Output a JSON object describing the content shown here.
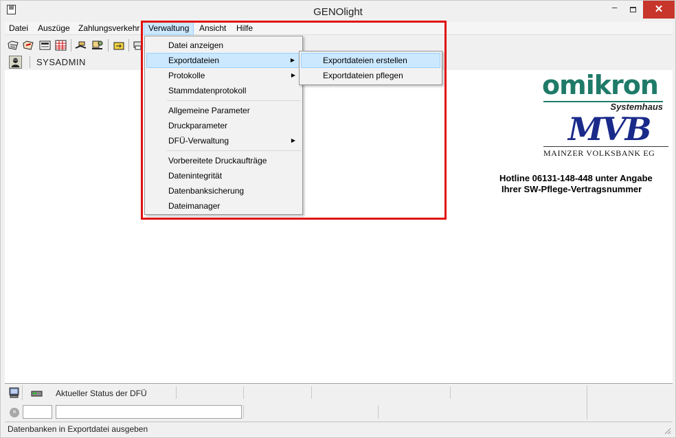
{
  "window": {
    "title": "GENOlight",
    "minimize_glyph": "–",
    "close_glyph": "✕"
  },
  "menubar": {
    "items": [
      {
        "label": "Datei"
      },
      {
        "label": "Auszüge"
      },
      {
        "label": "Zahlungsverkehr"
      },
      {
        "label": "Verwaltung",
        "active": true
      },
      {
        "label": "Ansicht"
      },
      {
        "label": "Hilfe"
      }
    ]
  },
  "user": {
    "name": "SYSADMIN"
  },
  "dropdown": {
    "items": [
      {
        "label": "Datei anzeigen"
      },
      {
        "label": "Exportdateien",
        "submenu": true,
        "highlighted": true
      },
      {
        "label": "Protokolle",
        "submenu": true
      },
      {
        "label": "Stammdatenprotokoll"
      },
      {
        "label": "Allgemeine Parameter"
      },
      {
        "label": "Druckparameter"
      },
      {
        "label": "DFÜ-Verwaltung",
        "submenu": true
      },
      {
        "label": "Vorbereitete Druckaufträge"
      },
      {
        "label": "Datenintegrität"
      },
      {
        "label": "Datenbanksicherung"
      },
      {
        "label": "Dateimanager"
      }
    ],
    "arrow": "▶"
  },
  "submenu": {
    "items": [
      {
        "label": "Exportdateien erstellen",
        "highlighted": true
      },
      {
        "label": "Exportdateien pflegen"
      }
    ]
  },
  "branding": {
    "omikron": "omikron",
    "omikron_sub": "Systemhaus",
    "mvb": "MVB",
    "mvb_name": "MAINZER VOLKSBANK EG",
    "hotline_line1": "Hotline 06131-148-448 unter Angabe",
    "hotline_line2": "Ihrer SW-Pflege-Vertragsnummer"
  },
  "status_panel": {
    "dfu_status_label": "Aktueller Status der DFÜ",
    "cancel_glyph": "×"
  },
  "statusbar": {
    "text": "Datenbanken in Exportdatei ausgeben"
  },
  "colors": {
    "highlight": "#cce8ff",
    "highlight_border": "#99d1ff",
    "annotation_frame": "#e01010",
    "omikron_green": "#1f7a68",
    "mvb_blue": "#1a2a8a"
  }
}
